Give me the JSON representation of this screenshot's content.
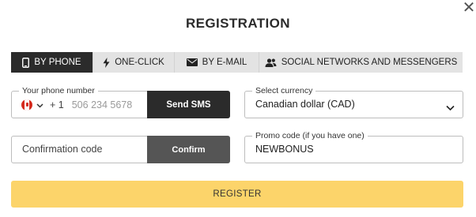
{
  "dialog": {
    "title": "REGISTRATION",
    "close_icon": "close-icon"
  },
  "tabs": [
    {
      "label": "BY PHONE",
      "icon": "phone-icon",
      "active": true
    },
    {
      "label": "ONE-CLICK",
      "icon": "lightning-icon",
      "active": false
    },
    {
      "label": "BY E-MAIL",
      "icon": "envelope-icon",
      "active": false
    },
    {
      "label": "SOCIAL NETWORKS AND MESSENGERS",
      "icon": "people-icon",
      "active": false
    }
  ],
  "phone": {
    "legend": "Your phone number",
    "country_icon": "canada-flag-icon",
    "dial_code": "+ 1",
    "placeholder": "506 234 5678",
    "send_label": "Send SMS"
  },
  "currency": {
    "legend": "Select currency",
    "value": "Canadian dollar (CAD)"
  },
  "confirmation": {
    "placeholder": "Confirmation code",
    "confirm_label": "Confirm"
  },
  "promo": {
    "legend": "Promo code (if you have one)",
    "value": "NEWBONUS"
  },
  "register": {
    "label": "REGISTER"
  },
  "colors": {
    "dark": "#2b2b2b",
    "tab_bg": "#e3e3e3",
    "confirm_bg": "#555555",
    "register_bg": "#fcd46a"
  }
}
